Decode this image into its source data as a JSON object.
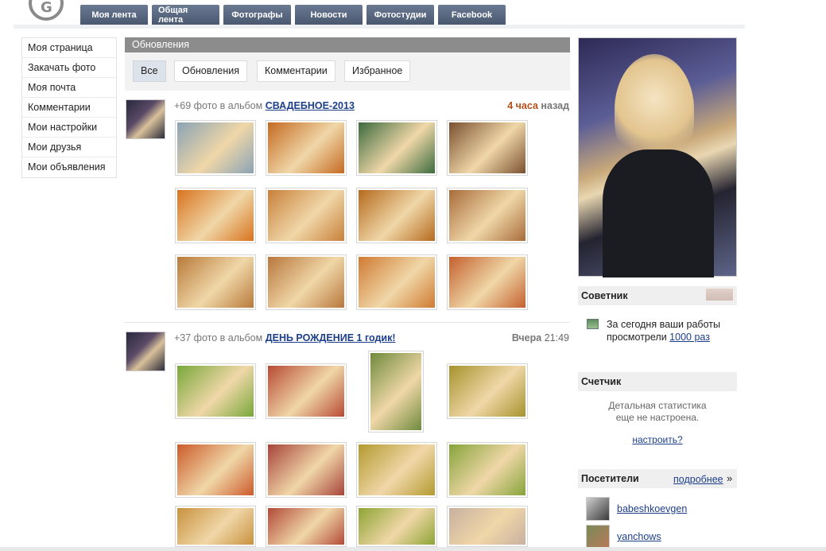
{
  "logo": {
    "glyph": "G"
  },
  "topnav": [
    "Моя лента",
    "Общая лента",
    "Фотографы",
    "Новости",
    "Фотостудии",
    "Facebook"
  ],
  "leftmenu": [
    "Моя страница",
    "Закачать фото",
    "Моя почта",
    "Комментарии",
    "Мои настройки",
    "Мои друзья",
    "Мои объявления"
  ],
  "updates": {
    "title": "Обновления",
    "filters": [
      "Все",
      "Обновления",
      "Комментарии",
      "Избранное"
    ],
    "active_filter": "Все"
  },
  "posts": [
    {
      "prefix": "+69 фото в альбом ",
      "album": "СВАДЕБНОЕ-2013",
      "time_hl": "4 часа",
      "time_rest": " назад",
      "thumb_colors": [
        "#8aa3b5",
        "#c56a22",
        "#3c6b3e",
        "#7a5030",
        "#d8731e",
        "#c8803a",
        "#b56a1e",
        "#a86b3a",
        "#b87a3a",
        "#b8773c",
        "#d07a32",
        "#c4602e"
      ]
    },
    {
      "prefix": "+37 фото в альбом ",
      "album": "ДЕНЬ РОЖДЕНИЕ 1 годик!",
      "time_hl": "Вчера",
      "time_rest": " 21:49",
      "thumb_colors": [
        "#78a83a",
        "#b84a34",
        "#6f8a3c",
        "#a6932e",
        "#cc5a2a",
        "#a8433a",
        "#b49a30",
        "#86a43a",
        "#c8923e",
        "#b24a36",
        "#8ea434",
        "#c8b0a0"
      ]
    }
  ],
  "sidebar": {
    "advisor_title": "Советник",
    "advisor_text": "За сегодня ваши работы просмотрели ",
    "advisor_link": "1000 раз",
    "counter_title": "Счетчик",
    "counter_text1": "Детальная статистика",
    "counter_text2": "еще не настроена.",
    "counter_link": "настроить?",
    "visitors_title": "Посетители",
    "visitors_more": "подробнее",
    "visitors_arrow": "»",
    "visitors": [
      "babeshkoevgen",
      "yanchows"
    ]
  }
}
